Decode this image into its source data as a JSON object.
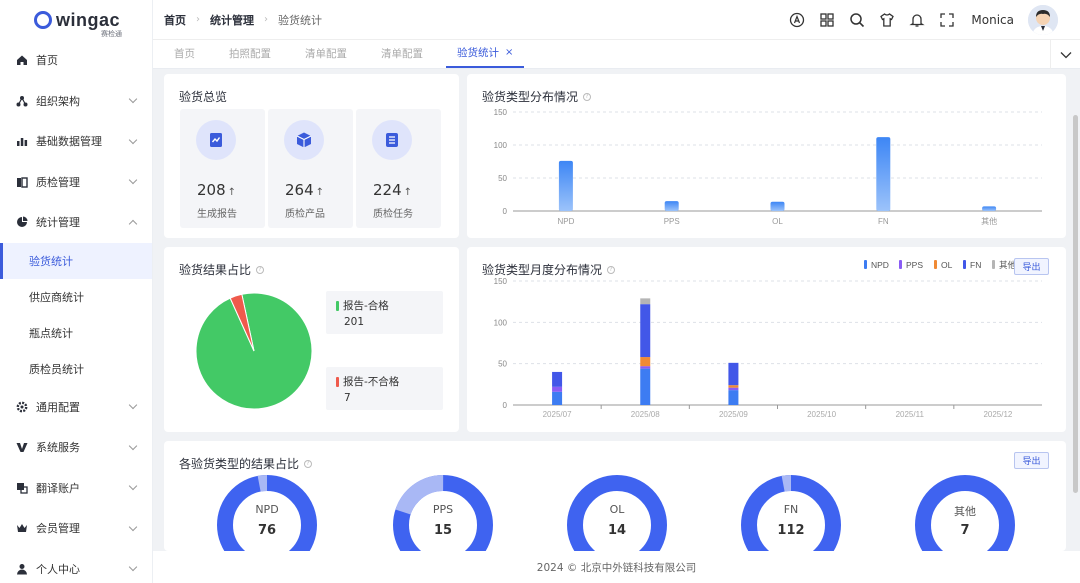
{
  "app": {
    "logo_text": "wingac",
    "logo_sub": "赛检通"
  },
  "sidebar": {
    "items": [
      {
        "label": "首页",
        "icon": "home-icon",
        "expandable": false
      },
      {
        "label": "组织架构",
        "icon": "org-icon",
        "expandable": true
      },
      {
        "label": "基础数据管理",
        "icon": "data-icon",
        "expandable": true
      },
      {
        "label": "质检管理",
        "icon": "inspection-icon",
        "expandable": true
      },
      {
        "label": "统计管理",
        "icon": "pie-icon",
        "expandable": true,
        "expanded": true
      }
    ],
    "sub_items": [
      {
        "label": "验货统计",
        "active": true
      },
      {
        "label": "供应商统计",
        "active": false
      },
      {
        "label": "瓶点统计",
        "active": false
      },
      {
        "label": "质检员统计",
        "active": false
      }
    ],
    "items_after": [
      {
        "label": "通用配置",
        "icon": "gear-icon"
      },
      {
        "label": "系统服务",
        "icon": "service-icon"
      },
      {
        "label": "翻译账户",
        "icon": "translate-icon"
      },
      {
        "label": "会员管理",
        "icon": "crown-icon"
      },
      {
        "label": "个人中心",
        "icon": "user-icon"
      }
    ]
  },
  "header": {
    "breadcrumb": [
      "首页",
      "统计管理",
      "验货统计"
    ],
    "user_name": "Monica"
  },
  "tabs": [
    {
      "label": "首页",
      "active": false
    },
    {
      "label": "拍照配置",
      "active": false
    },
    {
      "label": "清单配置",
      "active": false
    },
    {
      "label": "清单配置",
      "active": false
    },
    {
      "label": "验货统计",
      "active": true,
      "close": "×"
    }
  ],
  "overview": {
    "title": "验货总览",
    "items": [
      {
        "value": "208",
        "arrow": "↑",
        "label": "生成报告",
        "icon": "report-icon"
      },
      {
        "value": "264",
        "arrow": "↑",
        "label": "质检产品",
        "icon": "box-icon"
      },
      {
        "value": "224",
        "arrow": "↑",
        "label": "质检任务",
        "icon": "task-list-icon"
      }
    ]
  },
  "type_dist": {
    "title": "验货类型分布情况"
  },
  "result_ratio": {
    "title": "验货结果占比",
    "legend": [
      {
        "label": "报告-合格",
        "value": "201",
        "color": "#43c966"
      },
      {
        "label": "报告-不合格",
        "value": "7",
        "color": "#ef5a4c"
      }
    ]
  },
  "monthly": {
    "title": "验货类型月度分布情况",
    "export": "导出"
  },
  "type_result": {
    "title": "各验货类型的结果占比",
    "export": "导出",
    "rings": [
      {
        "name": "NPD",
        "value": "76",
        "fail_fraction": 0.03
      },
      {
        "name": "PPS",
        "value": "15",
        "fail_fraction": 0.2
      },
      {
        "name": "OL",
        "value": "14",
        "fail_fraction": 0.0
      },
      {
        "name": "FN",
        "value": "112",
        "fail_fraction": 0.03
      },
      {
        "name": "其他",
        "value": "7",
        "fail_fraction": 0.0
      }
    ]
  },
  "footer": {
    "text": "2024 © 北京中外链科技有限公司"
  },
  "chart_data": [
    {
      "type": "bar",
      "categories": [
        "NPD",
        "PPS",
        "OL",
        "FN",
        "其他"
      ],
      "values": [
        76,
        15,
        14,
        112,
        7
      ],
      "ylim": [
        0,
        150
      ],
      "yticks": [
        "0",
        "50",
        "100",
        "150"
      ],
      "grid": true
    },
    {
      "type": "pie",
      "labels": [
        "报告-合格",
        "报告-不合格"
      ],
      "values": [
        201,
        7
      ],
      "colors": [
        "#43c966",
        "#ef5a4c"
      ]
    },
    {
      "type": "bar",
      "stacked": true,
      "categories": [
        "2025/07",
        "2025/08",
        "2025/09",
        "2025/10",
        "2025/11",
        "2025/12"
      ],
      "ylim": [
        0,
        150
      ],
      "yticks": [
        "0",
        "50",
        "100",
        "150"
      ],
      "legend_position": "top-right",
      "series": [
        {
          "name": "NPD",
          "color": "#3d7cf2",
          "values": [
            16,
            44,
            18,
            0,
            0,
            0
          ]
        },
        {
          "name": "PPS",
          "color": "#8a5cf5",
          "values": [
            6,
            3,
            3,
            0,
            0,
            0
          ]
        },
        {
          "name": "OL",
          "color": "#f08a35",
          "values": [
            0,
            11,
            3,
            0,
            0,
            0
          ]
        },
        {
          "name": "FN",
          "color": "#4257e8",
          "values": [
            18,
            64,
            27,
            0,
            0,
            0
          ]
        },
        {
          "name": "其他",
          "color": "#b5b5b5",
          "values": [
            0,
            7,
            0,
            0,
            0,
            0
          ]
        }
      ]
    }
  ]
}
